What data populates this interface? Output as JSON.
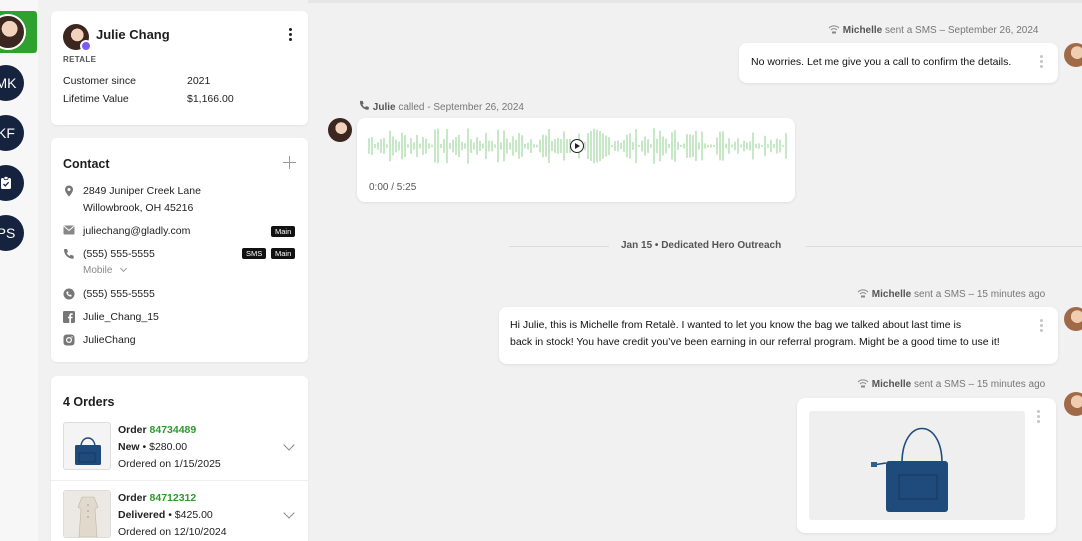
{
  "rail": {
    "items": [
      {
        "initials": "MK"
      },
      {
        "initials": "KF"
      },
      {
        "initials": "PS"
      }
    ]
  },
  "customer": {
    "name": "Julie Chang",
    "org": "RETALE",
    "since_label": "Customer since",
    "since_value": "2021",
    "ltv_label": "Lifetime Value",
    "ltv_value": "$1,166.00"
  },
  "contact": {
    "title": "Contact",
    "address_line1": "2849 Juniper Creek Lane",
    "address_line2": "Willowbrook, OH 45216",
    "email": "juliechang@gladly.com",
    "email_tag": "Main",
    "phone": "(555) 555-5555",
    "phone_tag_sms": "SMS",
    "phone_tag_main": "Main",
    "phone_type": "Mobile",
    "whatsapp": "(555) 555-5555",
    "facebook": "Julie_Chang_15",
    "instagram": "JulieChang"
  },
  "orders": {
    "title": "4 Orders",
    "items": [
      {
        "label": "Order",
        "number": "84734489",
        "status": "New",
        "amount": "$280.00",
        "date": "Ordered on 1/15/2025"
      },
      {
        "label": "Order",
        "number": "84712312",
        "status": "Delivered",
        "amount": "$425.00",
        "date": "Ordered on 12/10/2024"
      }
    ]
  },
  "conversation": {
    "msg1_meta_name": "Michelle",
    "msg1_meta_rest": " sent a SMS –  September 26, 2024",
    "msg1_text": "No worries. Let me give you a call to confirm the details.",
    "call_meta_name": "Julie",
    "call_meta_rest": " called - September 26, 2024",
    "call_time": "0:00 / 5:25",
    "day_sep": "Jan 15  •  Dedicated Hero Outreach",
    "msg2_meta_name": "Michelle",
    "msg2_meta_rest": " sent a SMS – 15 minutes ago",
    "msg2_line1": "Hi Julie, this is Michelle from Retalè. I wanted to let you know the bag we talked about last time is",
    "msg2_line2": "back in stock!  You have credit you’ve been earning in our referral program. Might be a good time to use it!",
    "msg3_meta_name": "Michelle",
    "msg3_meta_rest": " sent a SMS – 15 minutes ago"
  },
  "colors": {
    "accent": "#2fa12f",
    "navy": "#15233f",
    "waveform": "#8fd08f",
    "bag": "#1f4b7c"
  }
}
